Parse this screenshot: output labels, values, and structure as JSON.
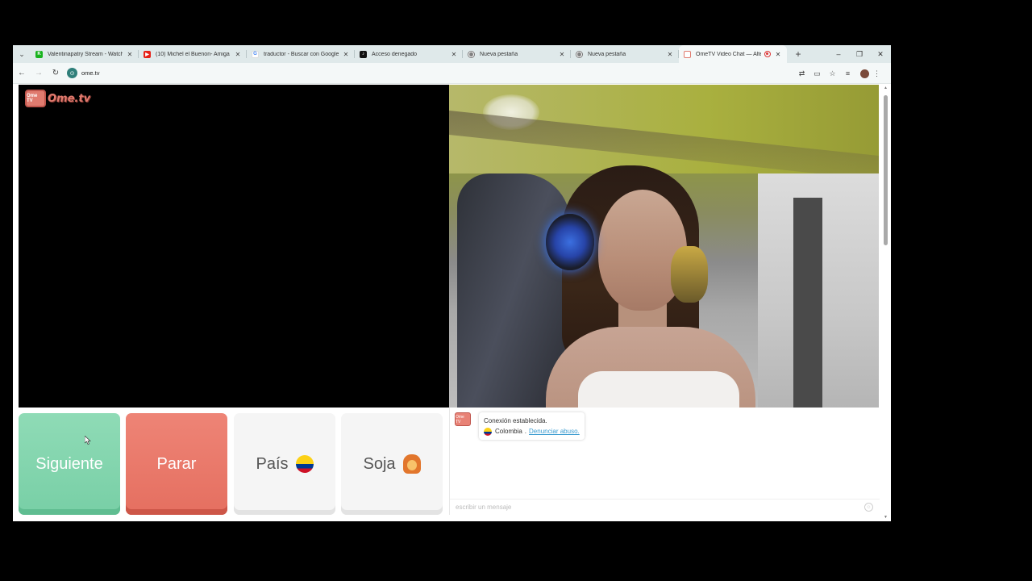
{
  "browser": {
    "tabs": [
      {
        "title": "Valentinapatry Stream - Watch",
        "favicon": "kick-icon",
        "color": "#19b31f",
        "glyph": "K"
      },
      {
        "title": "(10) Michel el Buenon- Amiga M",
        "favicon": "youtube-icon",
        "color": "#e62117",
        "glyph": "▶"
      },
      {
        "title": "traductor - Buscar con Google",
        "favicon": "google-icon",
        "color": "#4285f4",
        "glyph": "G"
      },
      {
        "title": "Acceso denegado",
        "favicon": "tiktok-icon",
        "color": "#111111",
        "glyph": "♪"
      },
      {
        "title": "Nueva pestaña",
        "favicon": "globe-icon",
        "color": "#666666",
        "glyph": "◍"
      },
      {
        "title": "Nueva pestaña",
        "favicon": "globe-icon",
        "color": "#666666",
        "glyph": "◍"
      },
      {
        "title": "OmeTV Video Chat — Alte",
        "favicon": "ometv-icon",
        "color": "#e07b6f",
        "glyph": "▣"
      }
    ],
    "new_tab": "+",
    "window_controls": {
      "minimize": "–",
      "restore": "❐",
      "close": "✕"
    },
    "url": "ome.tv"
  },
  "page": {
    "logo_badge": "Ome TV",
    "logo_text": "Ome.tv",
    "buttons": {
      "next": "Siguiente",
      "stop": "Parar",
      "country": "País",
      "gender": "Soja"
    },
    "chat": {
      "avatar_badge": "Ome TV",
      "system_message": "Conexión establecida.",
      "country": "Colombia",
      "separator": ".",
      "report_link": "Denunciar abuso.",
      "input_placeholder": "escribir un mensaje"
    }
  },
  "colors": {
    "next_button": "#78cfa6",
    "stop_button": "#e56f60",
    "link": "#3a9bd0"
  }
}
